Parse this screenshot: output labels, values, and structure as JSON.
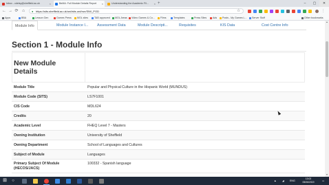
{
  "browser": {
    "tabs": [
      {
        "title": "Inbox - cdetsy@sheffield.ac.uk",
        "color": "#d93025",
        "active": false
      },
      {
        "title": "BeMA: Full Module Details Report",
        "color": "#1a73e8",
        "active": true
      },
      {
        "title": "Understanding the Academic Fil...",
        "color": "#f9ab00",
        "active": false
      }
    ],
    "new_tab": "+",
    "window_controls": {
      "minimize": "–",
      "maximize": "▢",
      "close": "✕"
    },
    "back": "←",
    "forward": "→",
    "reload": "⟳",
    "home": "⌂",
    "url": "https://sits.sheffield.ac.uk/urd/sits.urd/run/SIW_POD",
    "bookmarks": [
      {
        "label": "Apps",
        "color": "#5f6368"
      },
      {
        "label": "BBA",
        "color": "#4285f4"
      },
      {
        "label": "Lesson Gen",
        "color": "#34a853"
      },
      {
        "label": "Games Press",
        "color": "#ea4335"
      },
      {
        "label": "MOL sites",
        "color": "#fbbc04"
      },
      {
        "label": "TAB approved",
        "color": "#4285f4"
      },
      {
        "label": "MOL Areas",
        "color": "#34a853"
      },
      {
        "label": "Video Games & Co...",
        "color": "#ea4335"
      },
      {
        "label": "Films",
        "color": "#fbbc04"
      },
      {
        "label": "Templates",
        "color": "#4285f4"
      },
      {
        "label": "Press Sites",
        "color": "#34a853"
      },
      {
        "label": "Ads",
        "color": "#ea4335"
      },
      {
        "label": "Posts - My Games L...",
        "color": "#fbbc04"
      },
      {
        "label": "Server Stuff",
        "color": "#4285f4"
      },
      {
        "label": "Other bookmarks",
        "color": "#5f6368"
      }
    ]
  },
  "page": {
    "tabs": [
      {
        "label": "Module Info",
        "active": true
      },
      {
        "label": "Module Instance I...",
        "active": false
      },
      {
        "label": "Assessment Data",
        "active": false
      },
      {
        "label": "Module Descripti...",
        "active": false
      },
      {
        "label": "Requisites",
        "active": false
      },
      {
        "label": "KIS Data",
        "active": false
      },
      {
        "label": "Cost Centre Info",
        "active": false
      }
    ],
    "section_title": "Section 1 - Module Info",
    "panel_title": "New Module Details",
    "rows": [
      {
        "label": "Module Title",
        "value": "Popular and Physical Culture in the Hispanic World (MUNDUS)"
      },
      {
        "label": "Module Code (SITS)",
        "value": "LS7F1001"
      },
      {
        "label": "CIS Code",
        "value": "MDL624"
      },
      {
        "label": "Credits",
        "value": "20"
      },
      {
        "label": "Academic Level",
        "value": "FHEQ Level 7 - Masters"
      },
      {
        "label": "Owning Institution",
        "value": "University of Sheffield"
      },
      {
        "label": "Owning Department",
        "value": "School of Languages and Cultures"
      },
      {
        "label": "Subject of Module",
        "value": "Languages"
      },
      {
        "label": "Primary Subject Of Module (HECOS/JACS)",
        "value": "100332 - Spanish language"
      }
    ]
  },
  "taskbar": {
    "start": "⊞",
    "search": "○",
    "apps": [
      {
        "name": "task-view",
        "color": "#5b6b80"
      },
      {
        "name": "file-explorer",
        "color": "#f2c94c"
      },
      {
        "name": "chrome",
        "color": "#e94335"
      },
      {
        "name": "store",
        "color": "#3c8ce7"
      },
      {
        "name": "mail",
        "color": "#2d7dd2"
      },
      {
        "name": "word",
        "color": "#2b579a"
      },
      {
        "name": "media",
        "color": "#5a5a5a"
      },
      {
        "name": "settings",
        "color": "#7a7a7a"
      }
    ],
    "tray_lang": "ENG",
    "time": "13:02",
    "date": "05/06/2019"
  }
}
